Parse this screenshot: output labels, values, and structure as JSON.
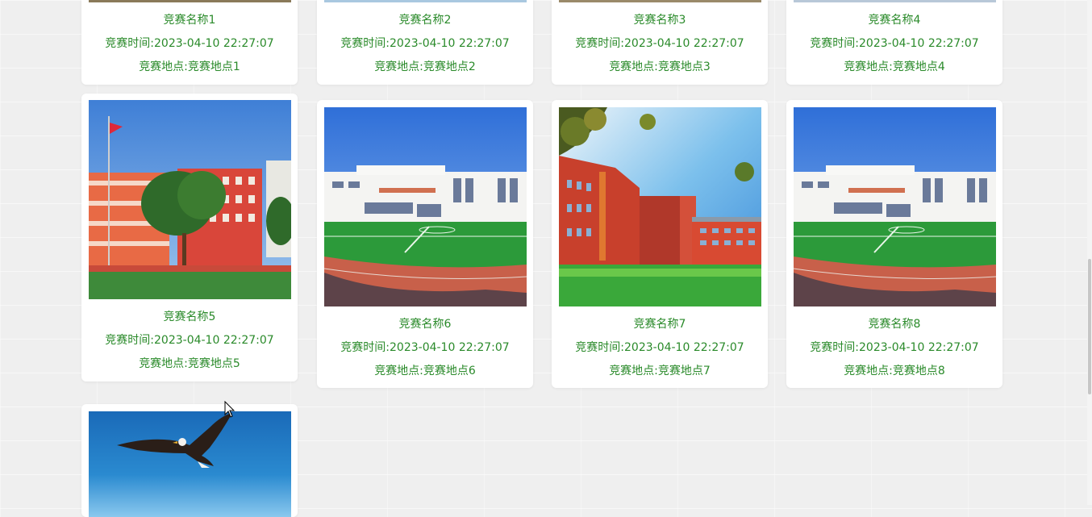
{
  "competitions": [
    {
      "name": "竞赛名称1",
      "time": "竞赛时间:2023-04-10 22:27:07",
      "place": "竞赛地点:竞赛地点1",
      "image": "school-photo"
    },
    {
      "name": "竞赛名称2",
      "time": "竞赛时间:2023-04-10 22:27:07",
      "place": "竞赛地点:竞赛地点2",
      "image": "school-photo"
    },
    {
      "name": "竞赛名称3",
      "time": "竞赛时间:2023-04-10 22:27:07",
      "place": "竞赛地点:竞赛地点3",
      "image": "school-photo"
    },
    {
      "name": "竞赛名称4",
      "time": "竞赛时间:2023-04-10 22:27:07",
      "place": "竞赛地点:竞赛地点4",
      "image": "school-photo"
    },
    {
      "name": "竞赛名称5",
      "time": "竞赛时间:2023-04-10 22:27:07",
      "place": "竞赛地点:竞赛地点5",
      "image": "school-flag-photo"
    },
    {
      "name": "竞赛名称6",
      "time": "竞赛时间:2023-04-10 22:27:07",
      "place": "竞赛地点:竞赛地点6",
      "image": "school-field-photo"
    },
    {
      "name": "竞赛名称7",
      "time": "竞赛时间:2023-04-10 22:27:07",
      "place": "竞赛地点:竞赛地点7",
      "image": "school-building-photo"
    },
    {
      "name": "竞赛名称8",
      "time": "竞赛时间:2023-04-10 22:27:07",
      "place": "竞赛地点:竞赛地点8",
      "image": "school-field-photo"
    },
    {
      "name": "",
      "time": "",
      "place": "",
      "image": "eagle-photo"
    }
  ],
  "colors": {
    "text_green": "#2a8a2a",
    "card_bg": "#ffffff",
    "page_bg": "#efefef"
  }
}
